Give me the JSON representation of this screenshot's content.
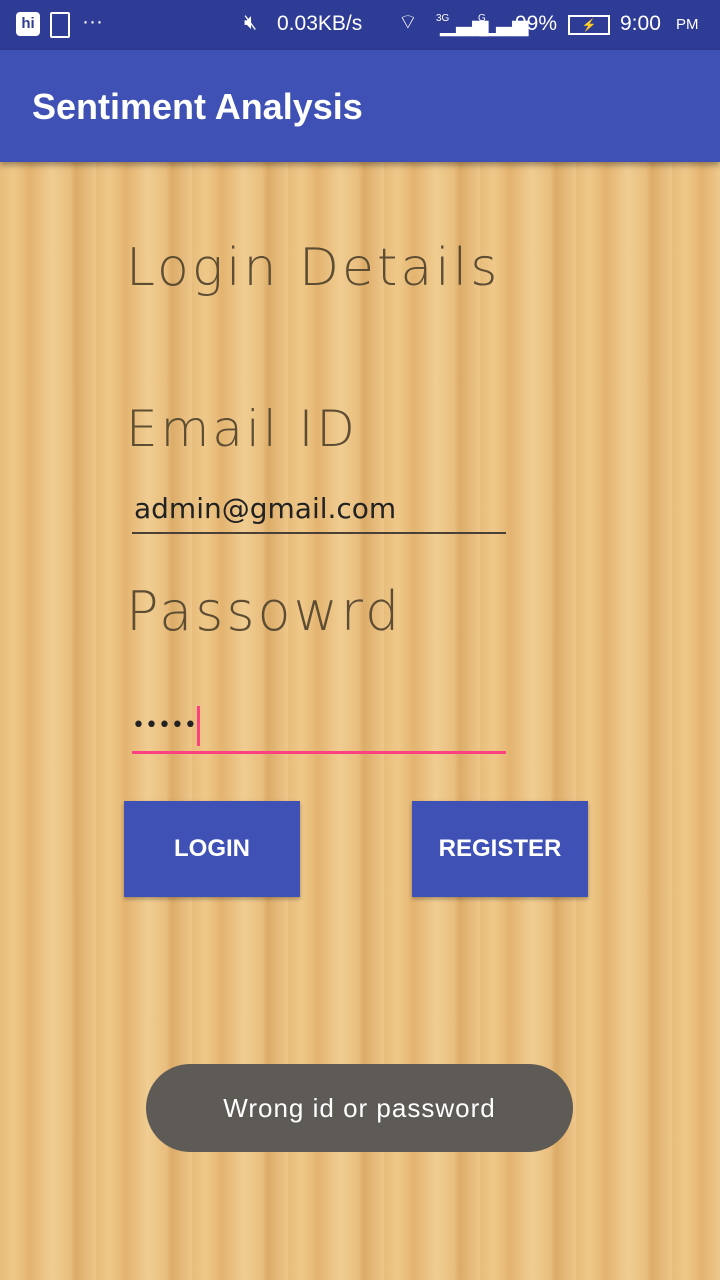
{
  "status_bar": {
    "net_speed": "0.03KB/s",
    "network1": "3G",
    "network2": "G",
    "battery": "99%",
    "time": "9:00",
    "ampm": "PM"
  },
  "app_bar": {
    "title": "Sentiment Analysis"
  },
  "form": {
    "heading": "Login Details",
    "email_label": "Email ID",
    "email_value": "admin@gmail.com",
    "password_label": "Passowrd",
    "password_value": "•••••"
  },
  "buttons": {
    "login": "LOGIN",
    "register": "REGISTER"
  },
  "toast": {
    "message": "Wrong id or password"
  },
  "colors": {
    "primary": "#3f51b5",
    "primary_dark": "#2f3c96",
    "accent": "#ff4081"
  }
}
